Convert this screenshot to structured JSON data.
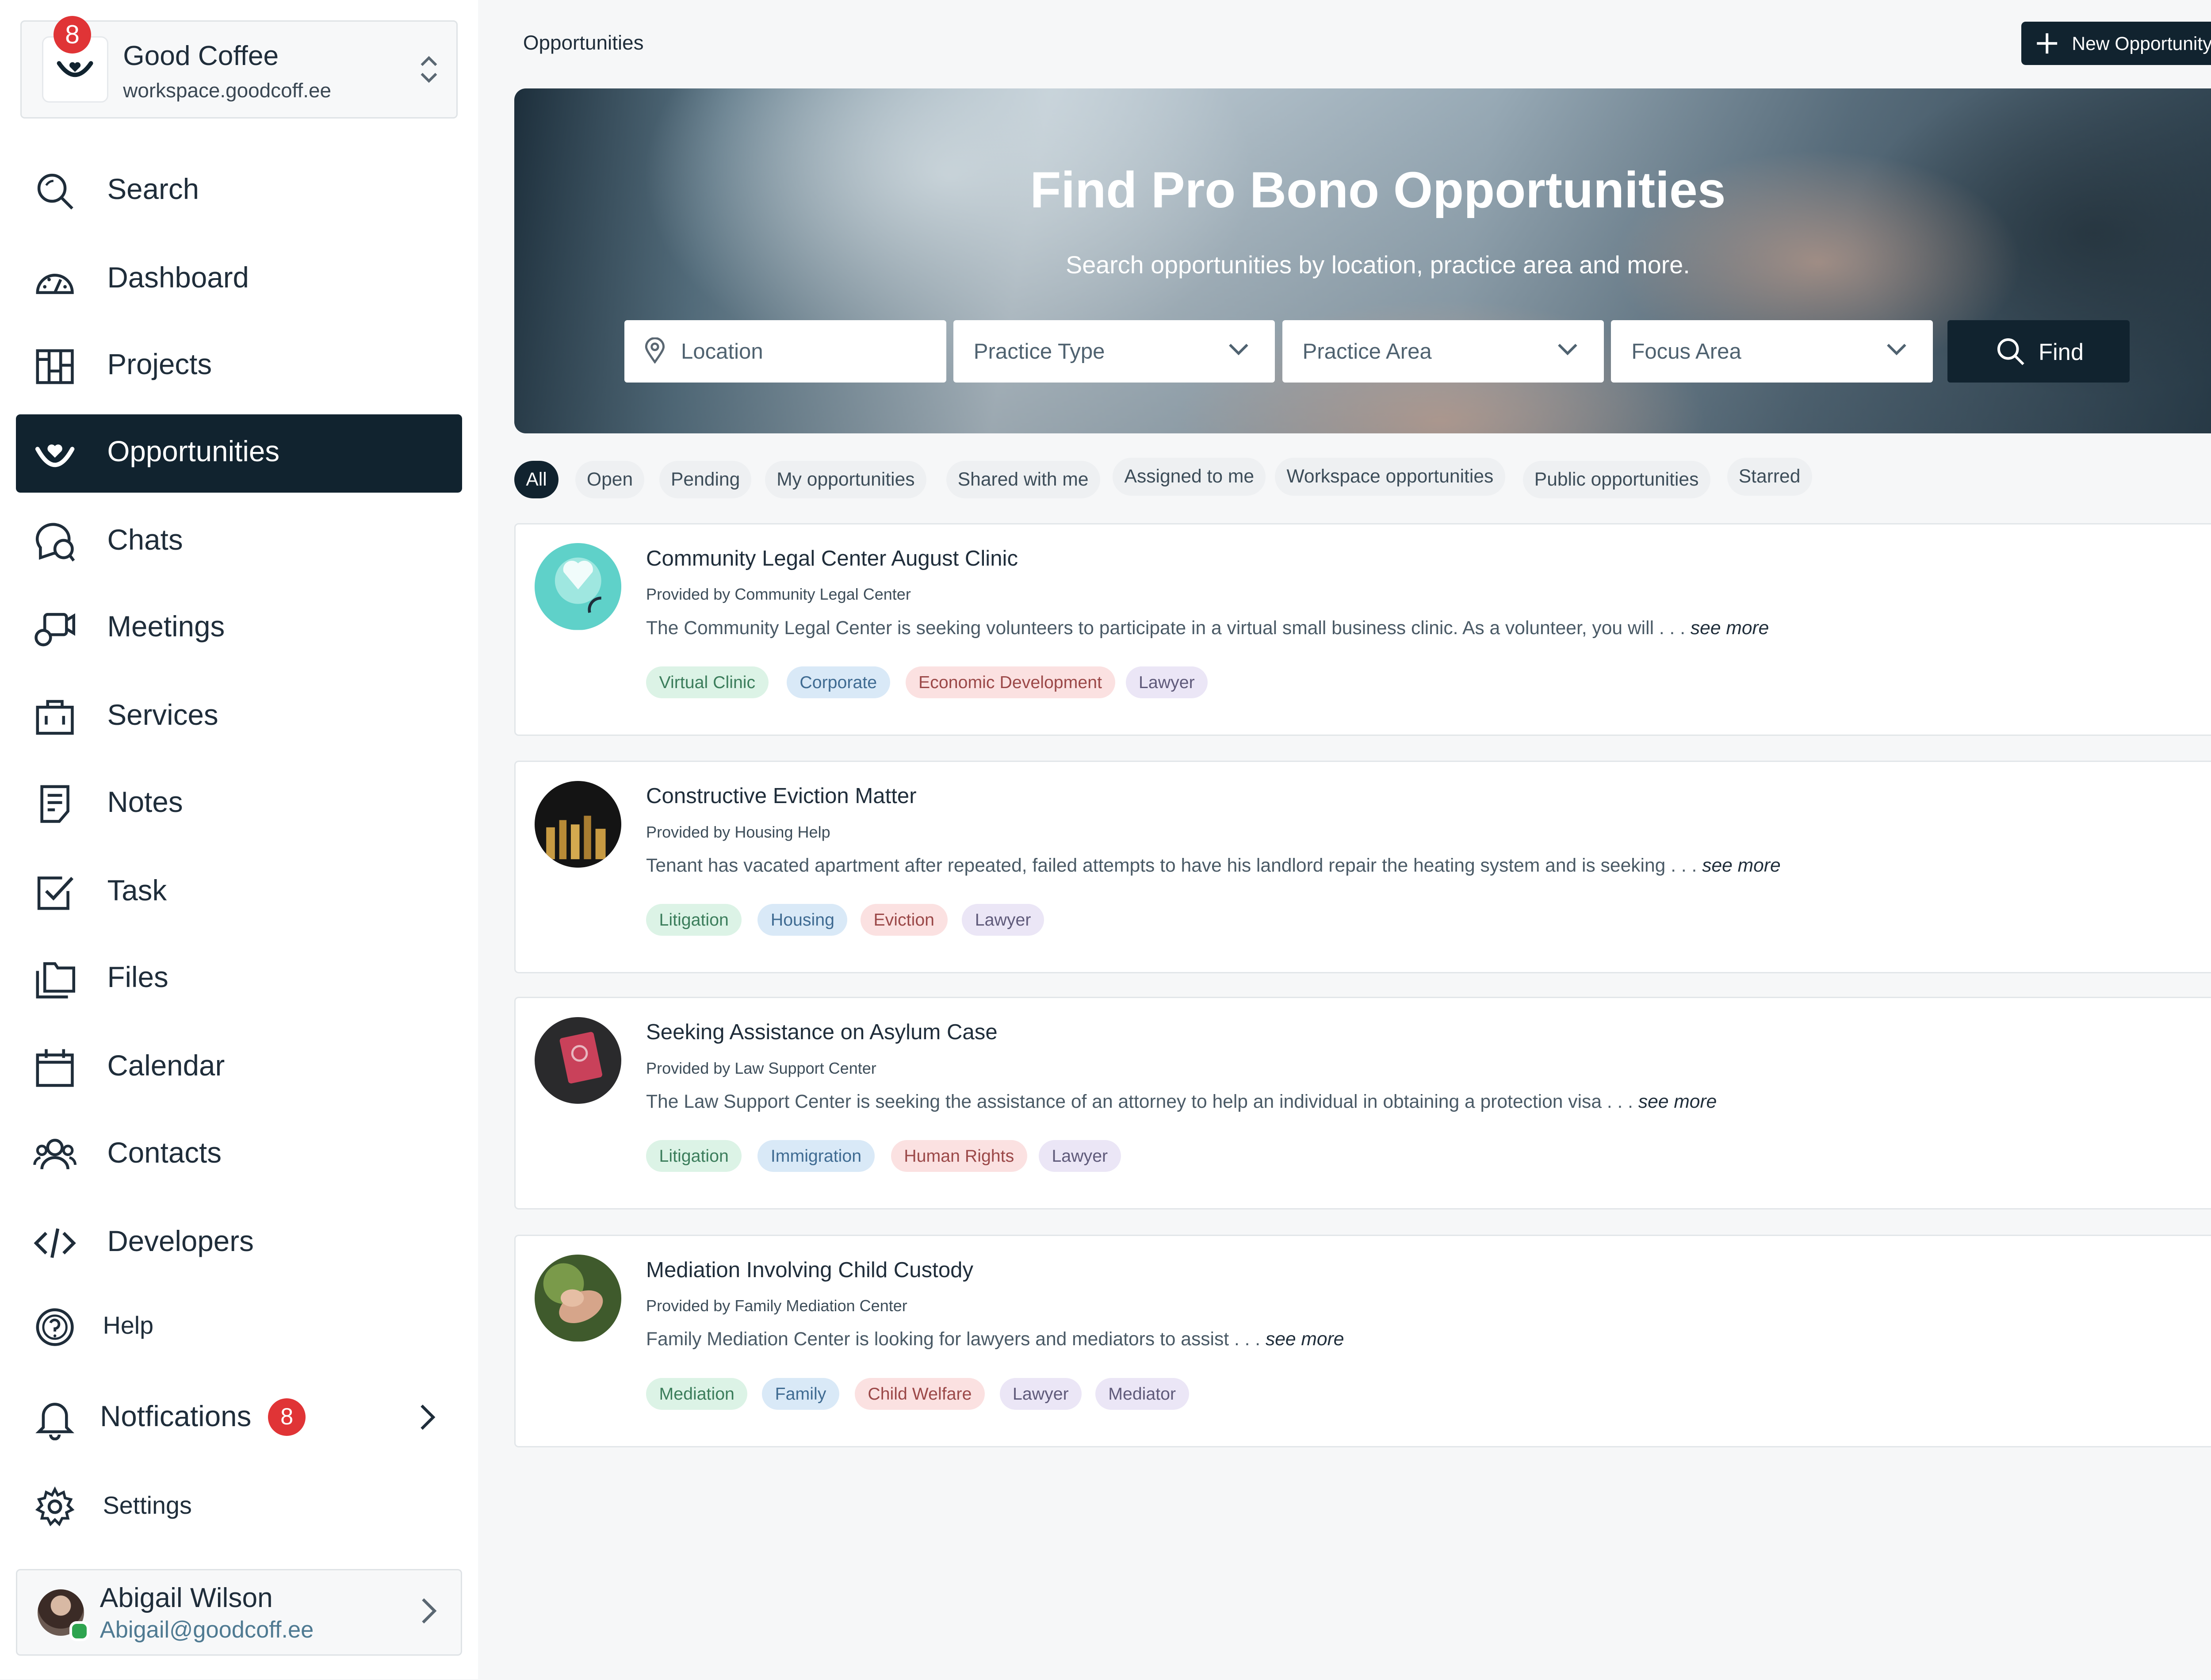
{
  "workspace": {
    "name": "Good Coffee",
    "domain": "workspace.goodcoff.ee",
    "badge_count": "8"
  },
  "nav": {
    "items": [
      {
        "label": "Search",
        "icon": "search-icon"
      },
      {
        "label": "Dashboard",
        "icon": "gauge-icon"
      },
      {
        "label": "Projects",
        "icon": "columns-icon"
      },
      {
        "label": "Opportunities",
        "icon": "heart-smile-icon",
        "active": true
      },
      {
        "label": "Chats",
        "icon": "chat-icon"
      },
      {
        "label": "Meetings",
        "icon": "video-icon"
      },
      {
        "label": "Services",
        "icon": "briefcase-icon"
      },
      {
        "label": "Notes",
        "icon": "note-icon"
      },
      {
        "label": "Task",
        "icon": "checkbox-icon"
      },
      {
        "label": "Files",
        "icon": "folder-icon"
      },
      {
        "label": "Calendar",
        "icon": "calendar-icon"
      },
      {
        "label": "Contacts",
        "icon": "contacts-icon"
      },
      {
        "label": "Developers",
        "icon": "code-icon"
      }
    ],
    "help": "Help",
    "notifications": {
      "label": "Notfications",
      "count": "8"
    },
    "settings": "Settings"
  },
  "user": {
    "name": "Abigail Wilson",
    "email": "Abigail@goodcoff.ee"
  },
  "header": {
    "breadcrumb": "Opportunities",
    "new_button": "New Opportunity"
  },
  "hero": {
    "title": "Find Pro Bono Opportunities",
    "subtitle": "Search opportunities by location, practice area and more.",
    "location_placeholder": "Location",
    "practice_type": "Practice Type",
    "practice_area": "Practice Area",
    "focus_area": "Focus Area",
    "find_label": "Find"
  },
  "filters": [
    "All",
    "Open",
    "Pending",
    "My opportunities",
    "Shared with me",
    "Assigned to me",
    "Workspace opportunities",
    "Public opportunities",
    "Starred"
  ],
  "filters_active": "All",
  "opportunities": [
    {
      "title": "Community Legal Center August Clinic",
      "provider": "Provided by Community Legal Center",
      "description": "The Community Legal Center is seeking volunteers to participate in a virtual small business clinic.  As a volunteer, you will . . .",
      "more": "see more",
      "tags": [
        "Virtual Clinic",
        "Corporate",
        "Economic Development",
        "Lawyer"
      ]
    },
    {
      "title": "Constructive Eviction Matter",
      "provider": "Provided by Housing Help",
      "description": "Tenant has vacated apartment after repeated, failed attempts to have his landlord repair the heating system and is seeking . . .",
      "more": "see more",
      "tags": [
        "Litigation",
        "Housing",
        "Eviction",
        "Lawyer"
      ]
    },
    {
      "title": "Seeking Assistance on Asylum Case",
      "provider": "Provided by Law Support Center",
      "description": "The Law Support Center is seeking the assistance of an attorney to help an individual in obtaining a protection visa  . . .",
      "more": "see more",
      "tags": [
        "Litigation",
        "Immigration",
        "Human Rights",
        "Lawyer"
      ]
    },
    {
      "title": "Mediation Involving Child Custody",
      "provider": "Provided by Family Mediation Center",
      "description": "Family Mediation Center is looking for lawyers and mediators to assist . . .",
      "more": "see more",
      "tags": [
        "Mediation",
        "Family",
        "Child Welfare",
        "Lawyer",
        "Mediator"
      ]
    }
  ],
  "colors": {
    "primary": "#11232f",
    "badge": "#e03436",
    "background": "#f6f7f8"
  }
}
